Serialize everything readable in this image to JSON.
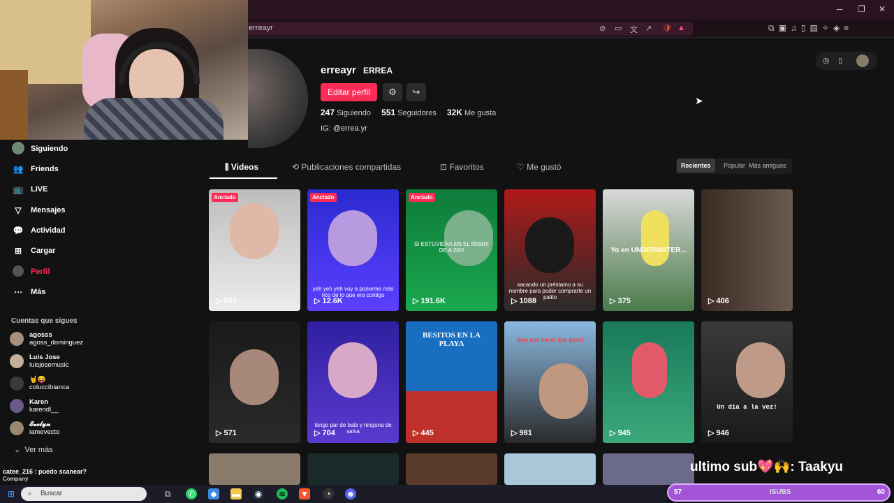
{
  "browser": {
    "url": "erreayr",
    "window_controls": [
      "─",
      "❐",
      "✕"
    ]
  },
  "profile": {
    "username": "erreayr",
    "nickname": "ERREA",
    "edit_label": "Editar perfil",
    "stats": [
      {
        "value": "247",
        "label": "Siguiendo"
      },
      {
        "value": "551",
        "label": "Seguidores"
      },
      {
        "value": "32K",
        "label": "Me gusta"
      }
    ],
    "bio": "IG: @errea.yr"
  },
  "sidebar": {
    "items": [
      {
        "label": "Siguiendo",
        "icon": "avatar"
      },
      {
        "label": "Friends",
        "icon": "friends-icon"
      },
      {
        "label": "LIVE",
        "icon": "live-icon"
      },
      {
        "label": "Mensajes",
        "icon": "messages-icon"
      },
      {
        "label": "Actividad",
        "icon": "activity-icon"
      },
      {
        "label": "Cargar",
        "icon": "upload-icon"
      },
      {
        "label": "Perfil",
        "icon": "profile-avatar"
      },
      {
        "label": "Más",
        "icon": "more-icon"
      }
    ],
    "following_title": "Cuentas que sigues",
    "accounts": [
      {
        "name": "agosss",
        "handle": "agoss_dominguez"
      },
      {
        "name": "Luis Jose",
        "handle": "luisjosemusic"
      },
      {
        "name": "🤘😝",
        "handle": "coluccibianca"
      },
      {
        "name": "Karen",
        "handle": "karendl__"
      },
      {
        "name": "𝓔𝓿𝓮𝓵𝔂𝓷",
        "handle": "iamevecto"
      }
    ],
    "see_more": "Ver más"
  },
  "tabs": [
    {
      "label": "Videos",
      "active": true
    },
    {
      "label": "Publicaciones compartidas",
      "active": false
    },
    {
      "label": "Favoritos",
      "active": false
    },
    {
      "label": "Me gustó",
      "active": false
    }
  ],
  "sort": [
    "Recientes",
    "Popular",
    "Más antiguos"
  ],
  "videos": [
    {
      "pinned": "Anclado",
      "plays": "681",
      "caption": ""
    },
    {
      "pinned": "Anclado",
      "plays": "12.6K",
      "caption": "yeh yeh yeh voy a ponerme más rico de lo que era contigo"
    },
    {
      "pinned": "Anclado",
      "plays": "191.6K",
      "caption": "SI ESTUVIERA EN EL REMIX DE A 200!"
    },
    {
      "pinned": "",
      "plays": "1088",
      "caption": "sacando un préstamo a su nombre para poder comprarte un palito"
    },
    {
      "pinned": "",
      "plays": "375",
      "caption": "Yo en UNDERWATER..."
    },
    {
      "pinned": "",
      "plays": "406",
      "caption": ""
    },
    {
      "pinned": "",
      "plays": "571",
      "caption": ""
    },
    {
      "pinned": "",
      "plays": "704",
      "caption": "tengo par de bala y ninguna de salva"
    },
    {
      "pinned": "",
      "plays": "445",
      "caption": "BESITOS EN LA PLAYA"
    },
    {
      "pinned": "",
      "plays": "981",
      "caption": "(hay que hacer que pase)"
    },
    {
      "pinned": "",
      "plays": "945",
      "caption": ""
    },
    {
      "pinned": "",
      "plays": "946",
      "caption": "Un dia a la vez!"
    }
  ],
  "stream": {
    "chat": "catee_216 : puedo scanear?",
    "chat_extra": "Company",
    "last_sub": "ultimo sub💖🙌: Taakyu",
    "bar_left": "57",
    "bar_mid": "ISUBS",
    "bar_right": "60"
  },
  "taskbar": {
    "search_placeholder": "Buscar"
  }
}
